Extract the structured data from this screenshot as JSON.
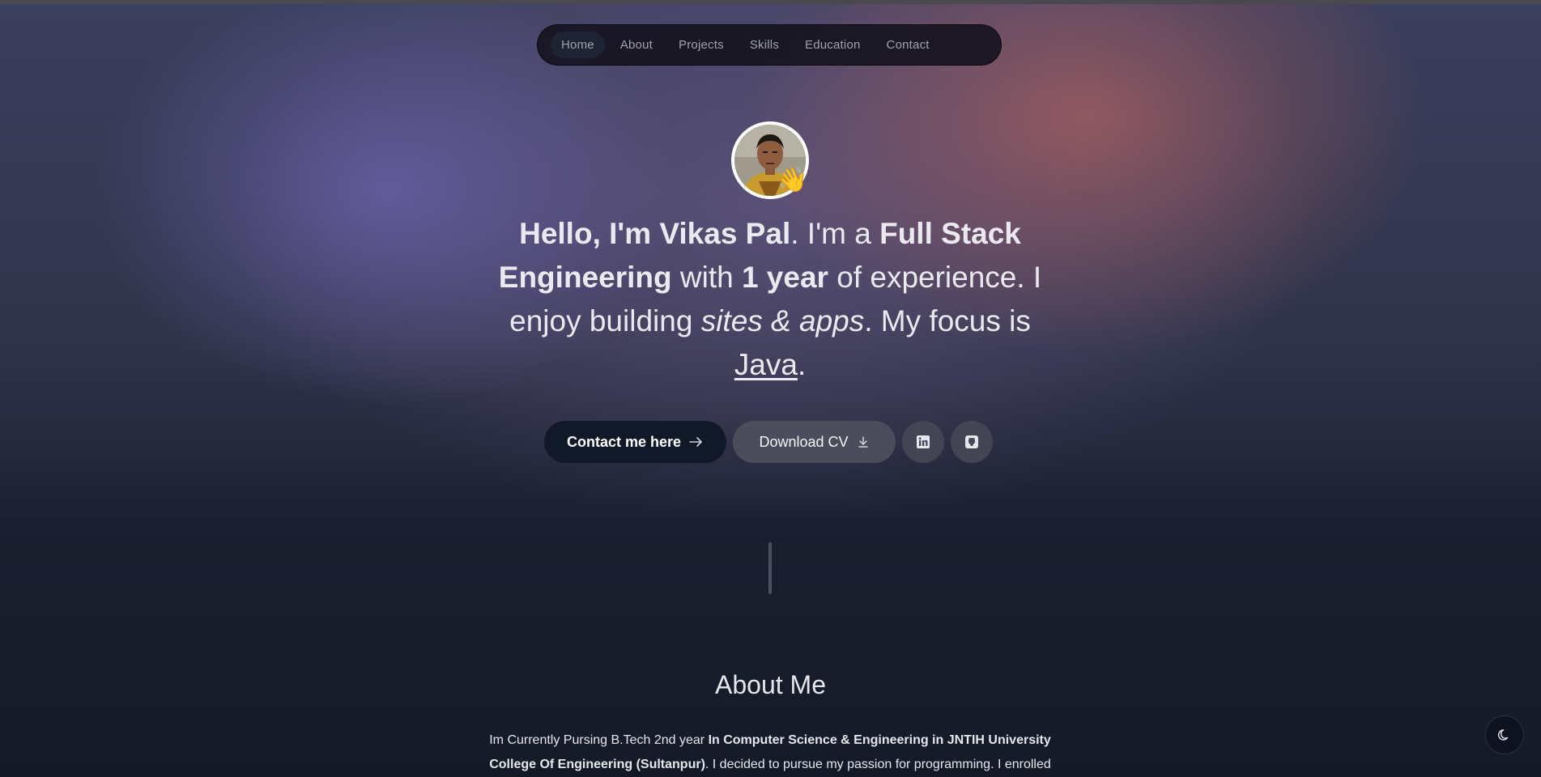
{
  "nav": {
    "items": [
      {
        "label": "Home",
        "active": true
      },
      {
        "label": "About"
      },
      {
        "label": "Projects"
      },
      {
        "label": "Skills"
      },
      {
        "label": "Education"
      },
      {
        "label": "Contact"
      }
    ]
  },
  "hero": {
    "avatar_icon": "profile-photo",
    "wave_emoji": "👋",
    "greeting": "Hello, I'm Vikas Pal",
    "dot1": ".",
    "im_a": " I'm a ",
    "role": "Full Stack Engineering",
    "with": " with ",
    "experience": "1 year",
    "of_exp": " of experience. I enjoy building ",
    "sites": "sites & apps",
    "focus": ". My focus is ",
    "tech": "Java",
    "dot2": "."
  },
  "buttons": {
    "contact_label": "Contact me here",
    "contact_icon": "arrow-right-icon",
    "cv_label": "Download CV",
    "cv_icon": "download-icon",
    "linkedin_icon": "linkedin-icon",
    "github_icon": "github-icon"
  },
  "about": {
    "title": "About Me",
    "p1": "Im Currently Pursing B.Tech 2nd year ",
    "p1_bold": "In Computer Science & Engineering in JNTIH University College Of Engineering (Sultanpur)",
    "p2": ". I decided to pursue my passion for programming. I enrolled"
  },
  "theme_toggle": {
    "icon": "moon-icon"
  },
  "colors": {
    "accent_dark": "#111827",
    "page_bg": "#121826"
  }
}
